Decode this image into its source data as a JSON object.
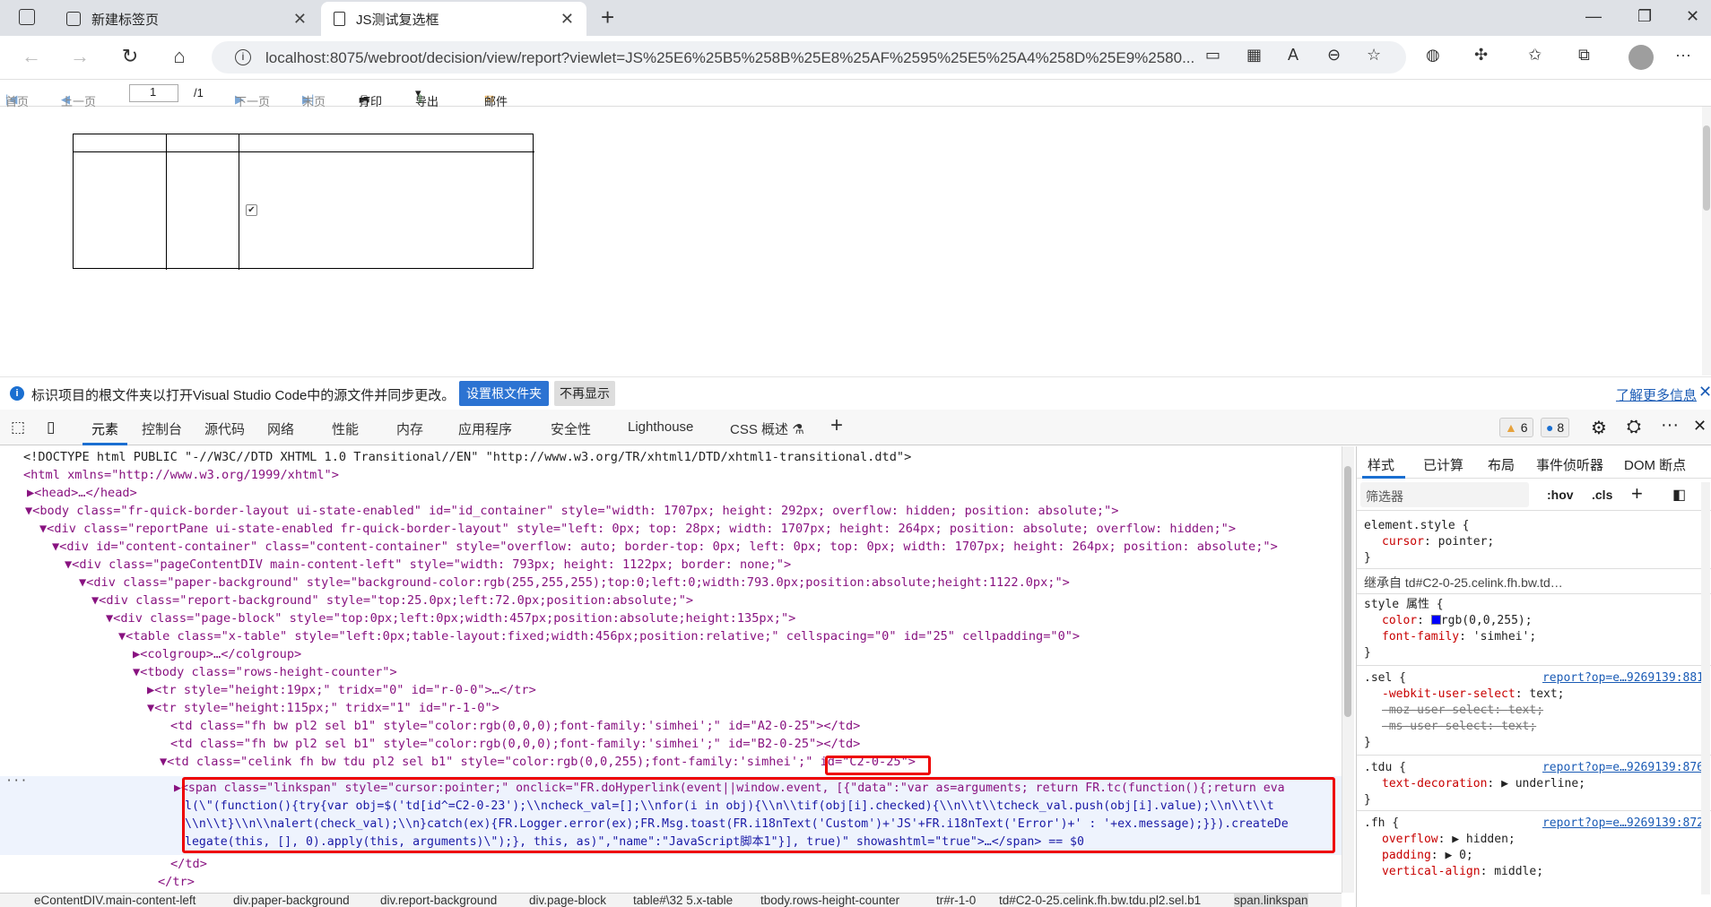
{
  "browser": {
    "tabs": [
      {
        "title": "新建标签页"
      },
      {
        "title": "JS测试复选框"
      }
    ],
    "url": "localhost:8075/webroot/decision/view/report?viewlet=JS%25E6%25B5%258B%25E8%25AF%2595%25E5%25A4%258D%25E9%2580..."
  },
  "report_toolbar": {
    "first": "首页",
    "prev": "上一页",
    "page_value": "1",
    "page_total": "/1",
    "next": "下一页",
    "last": "末页",
    "print": "打印",
    "export": "导出",
    "mail": "邮件"
  },
  "report": {
    "checkbox_checked": true
  },
  "infobar": {
    "text": "标识项目的根文件夹以打开Visual Studio Code中的源文件并同步更改。",
    "set_root": "设置根文件夹",
    "dont_show": "不再显示",
    "learn_more": "了解更多信息"
  },
  "devtools": {
    "tabs": [
      "元素",
      "控制台",
      "源代码",
      "网络",
      "性能",
      "内存",
      "应用程序",
      "安全性",
      "Lighthouse",
      "CSS 概述"
    ],
    "warnings": "6",
    "messages": "8",
    "dom_lines": [
      "<!DOCTYPE html PUBLIC \"-//W3C//DTD XHTML 1.0 Transitional//EN\" \"http://www.w3.org/TR/xhtml1/DTD/xhtml1-transitional.dtd\">",
      "<html xmlns=\"http://www.w3.org/1999/xhtml\">",
      "▶<head>…</head>",
      "▼<body class=\"fr-quick-border-layout ui-state-enabled\" id=\"id_container\" style=\"width: 1707px; height: 292px; overflow: hidden; position: absolute;\">",
      "▼<div class=\"reportPane ui-state-enabled fr-quick-border-layout\" style=\"left: 0px; top: 28px; width: 1707px; height: 264px; position: absolute; overflow: hidden;\">",
      "▼<div id=\"content-container\" class=\"content-container\" style=\"overflow: auto; border-top: 0px; left: 0px; top: 0px; width: 1707px; height: 264px; position: absolute;\">",
      "▼<div class=\"pageContentDIV main-content-left\" style=\"width: 793px; height: 1122px; border: none;\">",
      "▼<div class=\"paper-background\" style=\"background-color:rgb(255,255,255);top:0;left:0;width:793.0px;position:absolute;height:1122.0px;\">",
      "▼<div class=\"report-background\" style=\"top:25.0px;left:72.0px;position:absolute;\">",
      "▼<div class=\"page-block\" style=\"top:0px;left:0px;width:457px;position:absolute;height:135px;\">",
      "▼<table class=\"x-table\" style=\"left:0px;table-layout:fixed;width:456px;position:relative;\" cellspacing=\"0\" id=\"25\" cellpadding=\"0\">",
      "▶<colgroup>…</colgroup>",
      "▼<tbody class=\"rows-height-counter\">",
      "▶<tr style=\"height:19px;\" tridx=\"0\" id=\"r-0-0\">…</tr>",
      "▼<tr style=\"height:115px;\" tridx=\"1\" id=\"r-1-0\">",
      "<td class=\"fh bw pl2 sel b1\" style=\"color:rgb(0,0,0);font-family:'simhei';\" id=\"A2-0-25\"></td>",
      "<td class=\"fh bw pl2 sel b1\" style=\"color:rgb(0,0,0);font-family:'simhei';\" id=\"B2-0-25\"></td>",
      "▼<td class=\"celink fh bw tdu pl2 sel b1\" style=\"color:rgb(0,0,255);font-family:'simhei';\" id=\"C2-0-25\">",
      "▶<span class=\"linkspan\" style=\"cursor:pointer;\" onclick=\"FR.doHyperlink(event||window.event, [{\"data\":\"var as=arguments; return FR.tc(function(){;return eva",
      "l(\\\"(function(){try{var obj=$('td[id^=C2-0-23');\\\\ncheck_val=[];\\\\nfor(i in obj){\\\\n\\\\tif(obj[i].checked){\\\\n\\\\t\\\\tcheck_val.push(obj[i].value);\\\\n\\\\t\\\\t",
      "\\\\n\\\\t}\\\\n\\\\nalert(check_val);\\\\n}catch(ex){FR.Logger.error(ex);FR.Msg.toast(FR.i18nText('Custom')+'JS'+FR.i18nText('Error')+' : '+ex.message);}}).createDe",
      "legate(this, [], 0).apply(this, arguments)\\\");}, this, as)\",\"name\":\"JavaScript脚本1\"}], true)\" showashtml=\"true\">…</span> == $0",
      "</td>",
      "</tr>"
    ],
    "breadcrumb": [
      "eContentDIV.main-content-left",
      "div.paper-background",
      "div.report-background",
      "div.page-block",
      "table#\\32 5.x-table",
      "tbody.rows-height-counter",
      "tr#r-1-0",
      "td#C2-0-25.celink.fh.bw.tdu.pl2.sel.b1",
      "span.linkspan"
    ],
    "styles": {
      "tabs": [
        "样式",
        "已计算",
        "布局",
        "事件侦听器",
        "DOM 断点"
      ],
      "filter_placeholder": "筛选器",
      "hov": ":hov",
      "cls": ".cls",
      "inherited": "继承自 td#C2-0-25.celink.fh.bw.td…",
      "rules": [
        {
          "selector": "element.style {",
          "props": [
            [
              "cursor",
              "pointer;"
            ]
          ]
        },
        {
          "selector": "style 属性 {",
          "props": [
            [
              "color",
              "rgb(0,0,255);"
            ],
            [
              "font-family",
              "'simhei';"
            ]
          ]
        },
        {
          "selector": ".sel {",
          "source": "report?op=e…9269139:881",
          "props": [
            [
              "-webkit-user-select",
              "text;"
            ],
            [
              "-moz-user-select",
              "text;"
            ],
            [
              "-ms-user-select",
              "text;"
            ]
          ]
        },
        {
          "selector": ".tdu {",
          "source": "report?op=e…9269139:876",
          "props": [
            [
              "text-decoration",
              "▶ underline;"
            ]
          ]
        },
        {
          "selector": ".fh {",
          "source": "report?op=e…9269139:872",
          "props": [
            [
              "overflow",
              "▶ hidden;"
            ],
            [
              "padding",
              "▶ 0;"
            ],
            [
              "vertical-align",
              "middle;"
            ]
          ]
        }
      ]
    }
  },
  "colors": {
    "accent": "#1a6fd1",
    "highlight_red": "#e00000",
    "tag": "#881280",
    "attr_name": "#994500",
    "attr_value": "#1a1aa6"
  }
}
